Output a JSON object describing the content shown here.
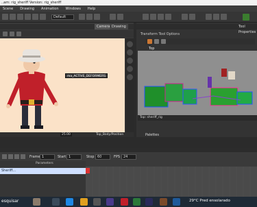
{
  "window": {
    "title": "..am: rig_sheriff Version: rig_sheriff"
  },
  "menu": [
    "Scene",
    "Drawing",
    "Animation",
    "Windows",
    "Help"
  ],
  "toolbar": {
    "view_select": "Default"
  },
  "left_tabs": [
    "Camera",
    "Drawing"
  ],
  "canvas": {
    "deformer_tag": "ma_ACTIVE_DEFORMERS",
    "zoom_value": "25.00",
    "layer_name": "Top_Body/Position"
  },
  "right_panel": {
    "tool_properties_label": "Tool Properties",
    "transform_options_label": "Transform Tool Options",
    "top_view_label": "Top",
    "bottom_label": "Top: sheriff_rig",
    "palettes_label": "Palettes"
  },
  "timeline": {
    "frame_label": "Frame",
    "frame_value": "1",
    "start_label": "Start",
    "start_value": "1",
    "stop_label": "Stop",
    "stop_value": "60",
    "fps_label": "FPS",
    "fps_value": "24",
    "params_label": "Parameters",
    "layer_row": "Sheriff..."
  },
  "taskbar": {
    "search_placeholder": "esquisar",
    "weather_text": "29°C  Pred ensolarado"
  },
  "colors": {
    "canvas_bg": "#fbe2c8",
    "shirt": "#c0202a",
    "hat": "#e8e4df",
    "pants": "#2b2d3a",
    "selected_layer": "#cfe0ff"
  }
}
